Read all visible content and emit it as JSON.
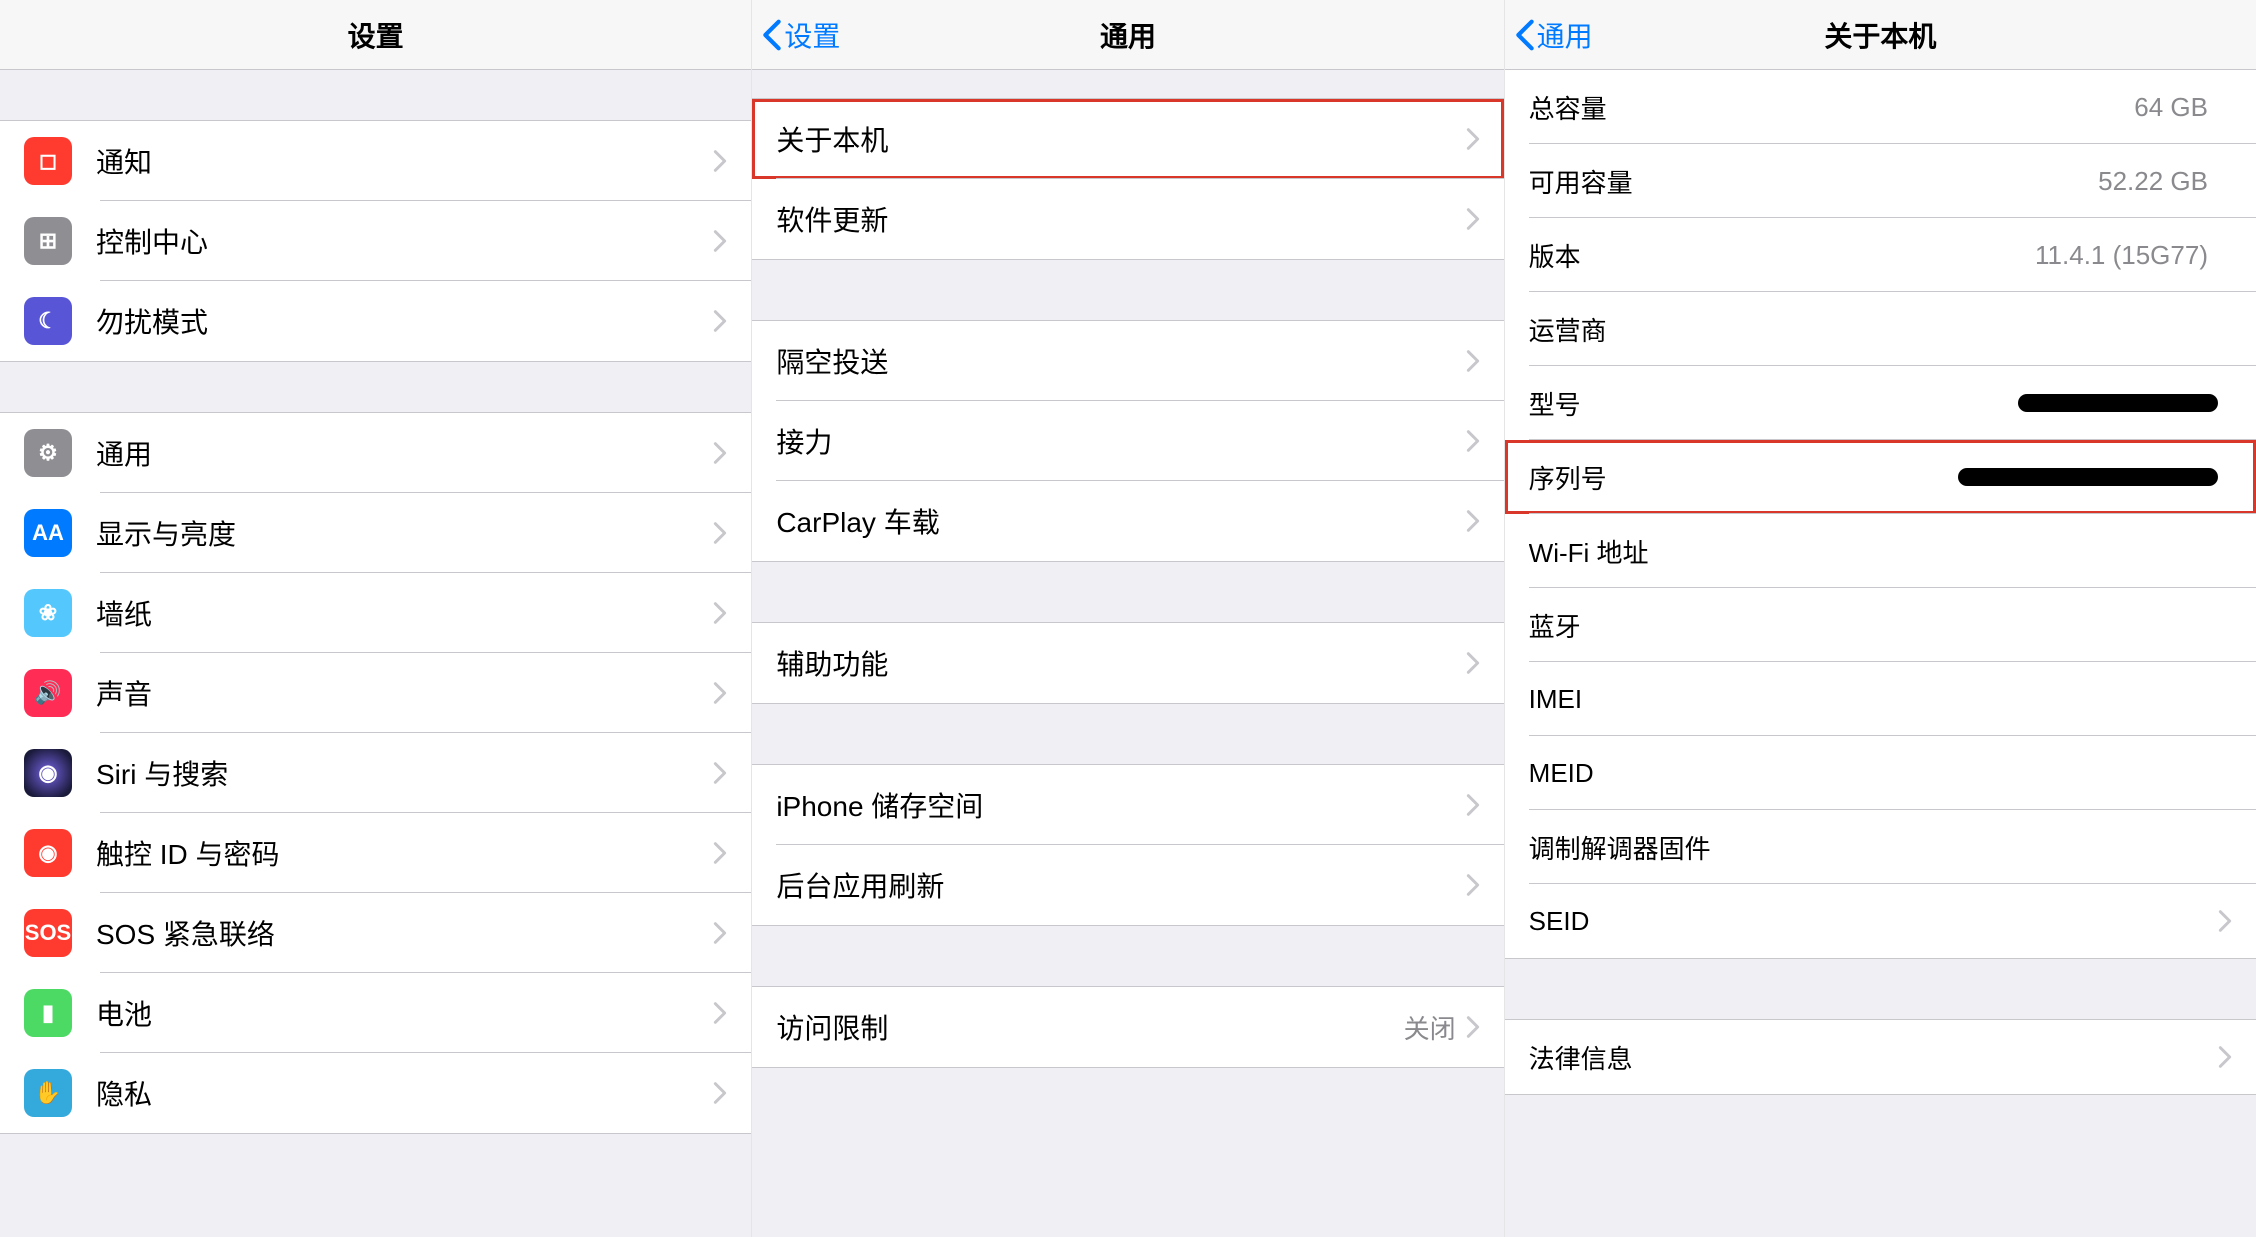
{
  "panel1": {
    "title": "设置",
    "grp1": [
      {
        "label": "通知",
        "icon": "notifications-icon",
        "bg": "bg-red",
        "glyph": "◻"
      },
      {
        "label": "控制中心",
        "icon": "control-center-icon",
        "bg": "bg-grey",
        "glyph": "⊞"
      },
      {
        "label": "勿扰模式",
        "icon": "do-not-disturb-icon",
        "bg": "bg-purple",
        "glyph": "☾"
      }
    ],
    "grp2": [
      {
        "label": "通用",
        "icon": "general-icon",
        "bg": "bg-grey",
        "glyph": "⚙"
      },
      {
        "label": "显示与亮度",
        "icon": "display-brightness-icon",
        "bg": "bg-blue",
        "glyph": "AA"
      },
      {
        "label": "墙纸",
        "icon": "wallpaper-icon",
        "bg": "bg-cyan",
        "glyph": "❀"
      },
      {
        "label": "声音",
        "icon": "sounds-icon",
        "bg": "bg-pink",
        "glyph": "🔊"
      },
      {
        "label": "Siri 与搜索",
        "icon": "siri-search-icon",
        "bg": "bg-siri",
        "glyph": "◉"
      },
      {
        "label": "触控 ID 与密码",
        "icon": "touchid-passcode-icon",
        "bg": "bg-red",
        "glyph": "◉"
      },
      {
        "label": "SOS 紧急联络",
        "icon": "sos-icon",
        "bg": "bg-sos",
        "glyph": "SOS"
      },
      {
        "label": "电池",
        "icon": "battery-icon",
        "bg": "bg-green",
        "glyph": "▮"
      },
      {
        "label": "隐私",
        "icon": "privacy-icon",
        "bg": "bg-lblue",
        "glyph": "✋"
      }
    ]
  },
  "panel2": {
    "back": "设置",
    "title": "通用",
    "grp1": [
      {
        "label": "关于本机",
        "highlight": true
      },
      {
        "label": "软件更新"
      }
    ],
    "grp2": [
      {
        "label": "隔空投送"
      },
      {
        "label": "接力"
      },
      {
        "label": "CarPlay 车载"
      }
    ],
    "grp3": [
      {
        "label": "辅助功能"
      }
    ],
    "grp4": [
      {
        "label": "iPhone 储存空间"
      },
      {
        "label": "后台应用刷新"
      }
    ],
    "grp5": [
      {
        "label": "访问限制",
        "value": "关闭"
      }
    ]
  },
  "panel3": {
    "back": "通用",
    "title": "关于本机",
    "lines": [
      {
        "label": "总容量",
        "value": "64 GB",
        "nochev": true
      },
      {
        "label": "可用容量",
        "value": "52.22 GB",
        "nochev": true
      },
      {
        "label": "版本",
        "value": "11.4.1 (15G77)",
        "nochev": true
      },
      {
        "label": "运营商",
        "value": "",
        "nochev": true
      },
      {
        "label": "型号",
        "value": "",
        "nochev": true,
        "redact": "narrow"
      },
      {
        "label": "序列号",
        "value": "",
        "nochev": true,
        "redact": "wide",
        "highlight": true
      },
      {
        "label": "Wi-Fi 地址",
        "value": "",
        "nochev": true
      },
      {
        "label": "蓝牙",
        "value": "",
        "nochev": true
      },
      {
        "label": "IMEI",
        "value": "",
        "nochev": true
      },
      {
        "label": "MEID",
        "value": "",
        "nochev": true
      },
      {
        "label": "调制解调器固件",
        "value": "",
        "nochev": true
      },
      {
        "label": "SEID",
        "value": "",
        "nochev": false
      }
    ],
    "bottom": [
      {
        "label": "法律信息",
        "nochev": false
      }
    ]
  }
}
